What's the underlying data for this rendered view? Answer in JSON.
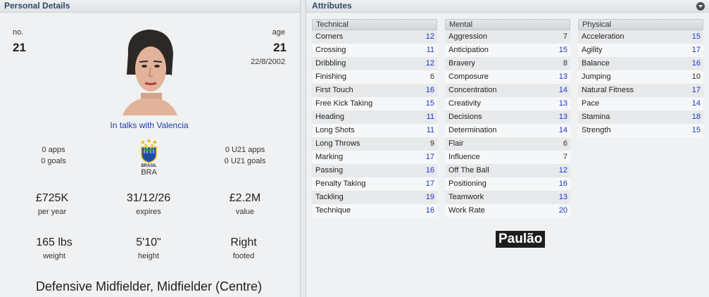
{
  "left_panel": {
    "title": "Personal Details",
    "number_label": "no.",
    "number": "21",
    "age_label": "age",
    "age": "21",
    "dob": "22/8/2002",
    "status": "In talks with Valencia",
    "apps": "0 apps",
    "goals": "0 goals",
    "u21_apps": "0 U21 apps",
    "u21_goals": "0 U21 goals",
    "nation_code": "BRA",
    "crest_text": "BRASIL",
    "wage": "£725K",
    "wage_label": "per year",
    "expires": "31/12/26",
    "expires_label": "expires",
    "value": "£2.2M",
    "value_label": "value",
    "weight": "165 lbs",
    "weight_label": "weight",
    "height": "5'10\"",
    "height_label": "height",
    "foot": "Right",
    "foot_label": "footed",
    "positions": "Defensive Midfielder, Midfielder (Centre)"
  },
  "right_panel": {
    "title": "Attributes",
    "menu_icon": "chevron-down-icon",
    "player_name": "Paulão",
    "groups": [
      {
        "name": "Technical",
        "attributes": [
          {
            "label": "Corners",
            "value": "12"
          },
          {
            "label": "Crossing",
            "value": "11"
          },
          {
            "label": "Dribbling",
            "value": "12"
          },
          {
            "label": "Finishing",
            "value": "6"
          },
          {
            "label": "First Touch",
            "value": "16"
          },
          {
            "label": "Free Kick Taking",
            "value": "15"
          },
          {
            "label": "Heading",
            "value": "11"
          },
          {
            "label": "Long Shots",
            "value": "11"
          },
          {
            "label": "Long Throws",
            "value": "9"
          },
          {
            "label": "Marking",
            "value": "17"
          },
          {
            "label": "Passing",
            "value": "16"
          },
          {
            "label": "Penalty Taking",
            "value": "17"
          },
          {
            "label": "Tackling",
            "value": "19"
          },
          {
            "label": "Technique",
            "value": "16"
          }
        ]
      },
      {
        "name": "Mental",
        "attributes": [
          {
            "label": "Aggression",
            "value": "7"
          },
          {
            "label": "Anticipation",
            "value": "15"
          },
          {
            "label": "Bravery",
            "value": "8"
          },
          {
            "label": "Composure",
            "value": "13"
          },
          {
            "label": "Concentration",
            "value": "14"
          },
          {
            "label": "Creativity",
            "value": "13"
          },
          {
            "label": "Decisions",
            "value": "13"
          },
          {
            "label": "Determination",
            "value": "14"
          },
          {
            "label": "Flair",
            "value": "6"
          },
          {
            "label": "Influence",
            "value": "7"
          },
          {
            "label": "Off The Ball",
            "value": "12"
          },
          {
            "label": "Positioning",
            "value": "16"
          },
          {
            "label": "Teamwork",
            "value": "13"
          },
          {
            "label": "Work Rate",
            "value": "20"
          }
        ]
      },
      {
        "name": "Physical",
        "attributes": [
          {
            "label": "Acceleration",
            "value": "15"
          },
          {
            "label": "Agility",
            "value": "17"
          },
          {
            "label": "Balance",
            "value": "16"
          },
          {
            "label": "Jumping",
            "value": "10"
          },
          {
            "label": "Natural Fitness",
            "value": "17"
          },
          {
            "label": "Pace",
            "value": "14"
          },
          {
            "label": "Stamina",
            "value": "18"
          },
          {
            "label": "Strength",
            "value": "15"
          }
        ]
      }
    ]
  },
  "colors": {
    "header_text": "#2f4a66",
    "good_value": "#1a36c7",
    "status_link": "#1d3fa8"
  }
}
